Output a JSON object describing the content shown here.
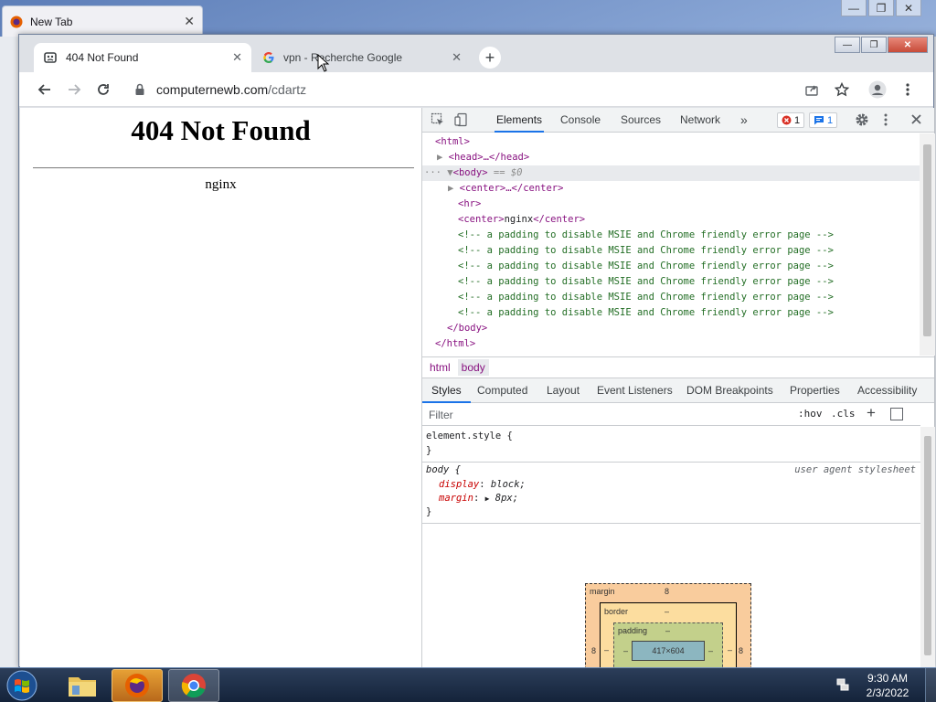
{
  "background_window": {
    "tab_title": "New Tab",
    "close_label": "✕",
    "controls": [
      "—",
      "❐",
      "✕"
    ]
  },
  "chrome": {
    "tabs": [
      {
        "title": "404 Not Found",
        "close": "✕"
      },
      {
        "title": "vpn - Recherche Google",
        "close": "✕"
      }
    ],
    "new_tab_label": "+",
    "window_controls": {
      "minimize": "—",
      "maximize": "❐",
      "close": "✕"
    },
    "address": {
      "host": "computernewb.com",
      "path": "/cdartz"
    }
  },
  "page": {
    "heading": "404 Not Found",
    "server": "nginx"
  },
  "devtools": {
    "tabs": [
      "Elements",
      "Console",
      "Sources",
      "Network"
    ],
    "more": "»",
    "errors": "1",
    "messages": "1",
    "dom": {
      "html_open": "<html>",
      "head": "<head>…</head>",
      "body_open": "<body>",
      "body_eq": " == $0",
      "center1": "<center>…</center>",
      "hr": "<hr>",
      "center2_open": "<center>",
      "center2_text": "nginx",
      "center2_close": "</center>",
      "comment": "<!-- a padding to disable MSIE and Chrome friendly error page -->",
      "body_close": "</body>",
      "html_close": "</html>"
    },
    "breadcrumbs": [
      "html",
      "body"
    ],
    "style_tabs": [
      "Styles",
      "Computed",
      "Layout",
      "Event Listeners",
      "DOM Breakpoints",
      "Properties",
      "Accessibility"
    ],
    "filter_placeholder": "Filter",
    "hov": ":hov",
    "cls": ".cls",
    "add_rule": "+",
    "rules": {
      "element_style": "element.style {",
      "close_brace": "}",
      "body_selector": "body {",
      "ua_label": "user agent stylesheet",
      "display_prop": "display",
      "display_val": "block;",
      "margin_prop": "margin",
      "margin_val": "8px;",
      "colon": ":"
    },
    "box_model": {
      "margin_label": "margin",
      "margin_top": "8",
      "margin_left": "8",
      "margin_right": "8",
      "margin_bottom": "–",
      "border_label": "border",
      "border_top": "–",
      "border_left": "–",
      "border_right": "–",
      "border_bottom": "–",
      "padding_label": "padding",
      "padding_top": "–",
      "padding_left": "–",
      "padding_right": "–",
      "padding_bottom": "–",
      "content": "417×604"
    }
  },
  "taskbar": {
    "time": "9:30 AM",
    "date": "2/3/2022"
  },
  "colors": {
    "accent_blue": "#1a73e8",
    "error_red": "#d93025",
    "tag_purple": "#881280",
    "comment_green": "#236e25"
  }
}
